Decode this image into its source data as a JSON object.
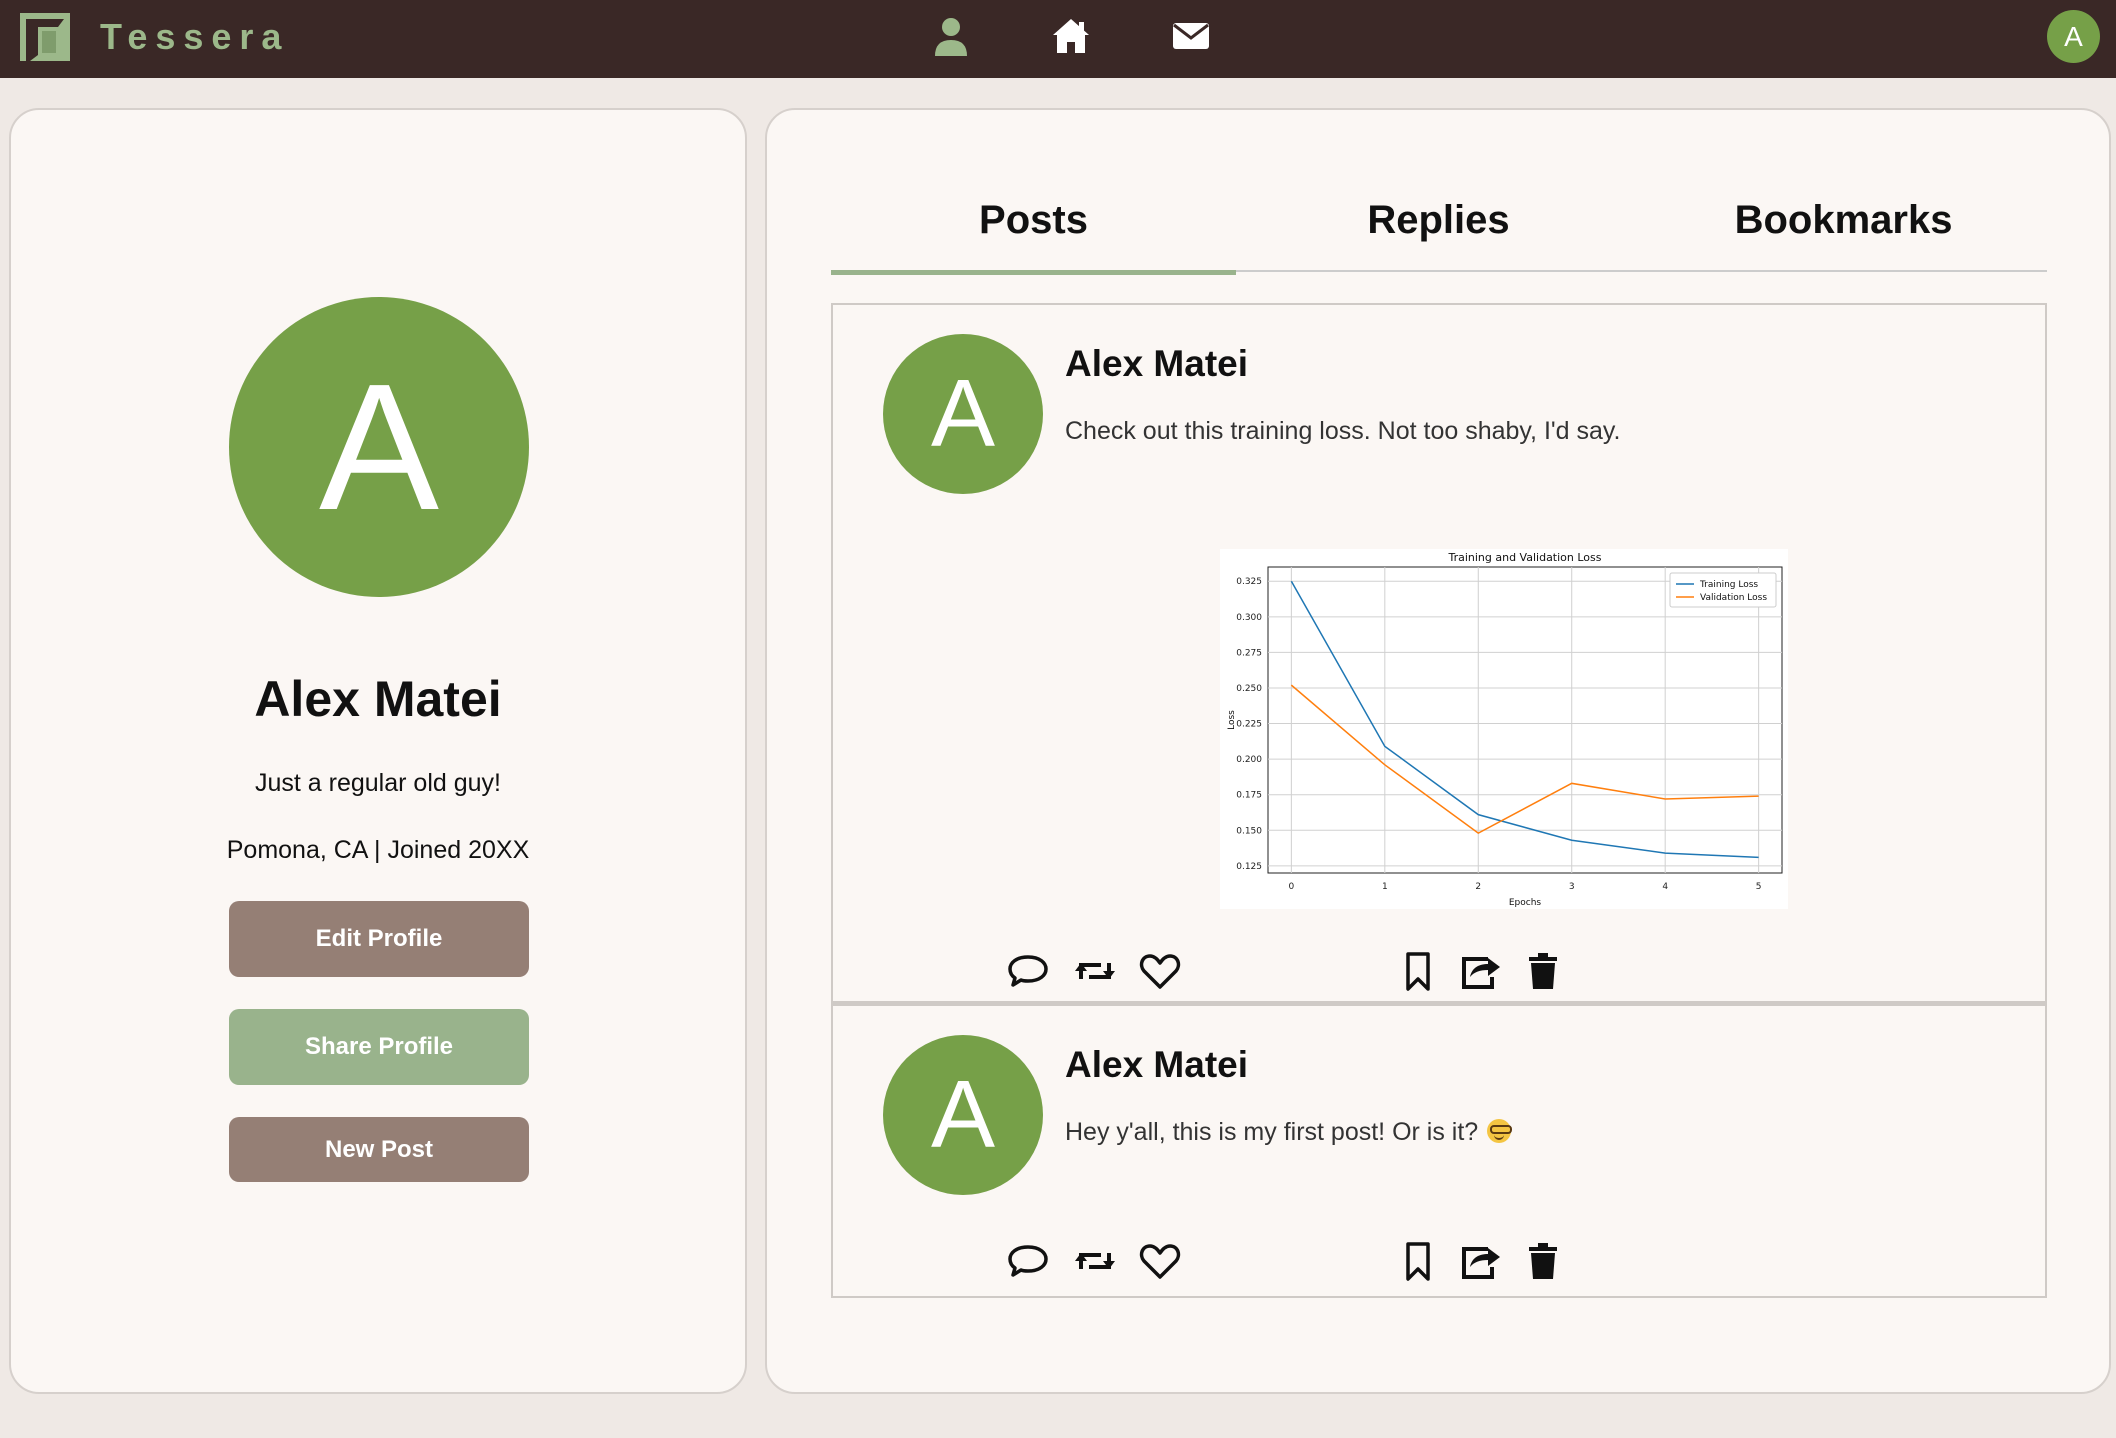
{
  "app": {
    "brand": "Tessera",
    "user_initial": "A"
  },
  "nav": {
    "profile_icon": "user-icon",
    "home_icon": "home-icon",
    "messages_icon": "envelope-icon"
  },
  "profile": {
    "initial": "A",
    "name": "Alex Matei",
    "bio": "Just a regular old guy!",
    "meta": "Pomona, CA | Joined 20XX",
    "buttons": {
      "edit": "Edit Profile",
      "share": "Share Profile",
      "new_post": "New Post"
    }
  },
  "tabs": [
    "Posts",
    "Replies",
    "Bookmarks"
  ],
  "active_tab": "Posts",
  "posts": [
    {
      "initial": "A",
      "author": "Alex Matei",
      "text": "Check out this training loss. Not too shaby, I'd say.",
      "has_chart": true
    },
    {
      "initial": "A",
      "author": "Alex Matei",
      "text": "Hey y'all, this is my first post! Or is it?",
      "emoji": "nerd-face-emoji"
    }
  ],
  "actions": [
    "comment-icon",
    "repost-icon",
    "like-icon",
    "bookmark-icon",
    "share-icon",
    "delete-icon"
  ],
  "colors": {
    "topbar": "#3a2826",
    "brand": "#9cb88a",
    "avatar": "#76a048",
    "button_brown": "#957f75",
    "button_green": "#99b38c",
    "panel": "#fbf7f4",
    "background": "#efe9e5"
  },
  "chart_data": {
    "type": "line",
    "title": "Training and Validation Loss",
    "xlabel": "Epochs",
    "ylabel": "Loss",
    "x": [
      0,
      1,
      2,
      3,
      4,
      5
    ],
    "xticks": [
      "0",
      "1",
      "2",
      "3",
      "4",
      "5"
    ],
    "yticks": [
      "0.125",
      "0.150",
      "0.175",
      "0.200",
      "0.225",
      "0.250",
      "0.275",
      "0.300",
      "0.325"
    ],
    "ylim": [
      0.12,
      0.335
    ],
    "grid": true,
    "legend_position": "top-right",
    "series": [
      {
        "name": "Training Loss",
        "color": "#1f77b4",
        "values": [
          0.325,
          0.209,
          0.161,
          0.143,
          0.134,
          0.131
        ]
      },
      {
        "name": "Validation Loss",
        "color": "#ff7f0e",
        "values": [
          0.252,
          0.196,
          0.148,
          0.183,
          0.172,
          0.174
        ]
      }
    ]
  }
}
